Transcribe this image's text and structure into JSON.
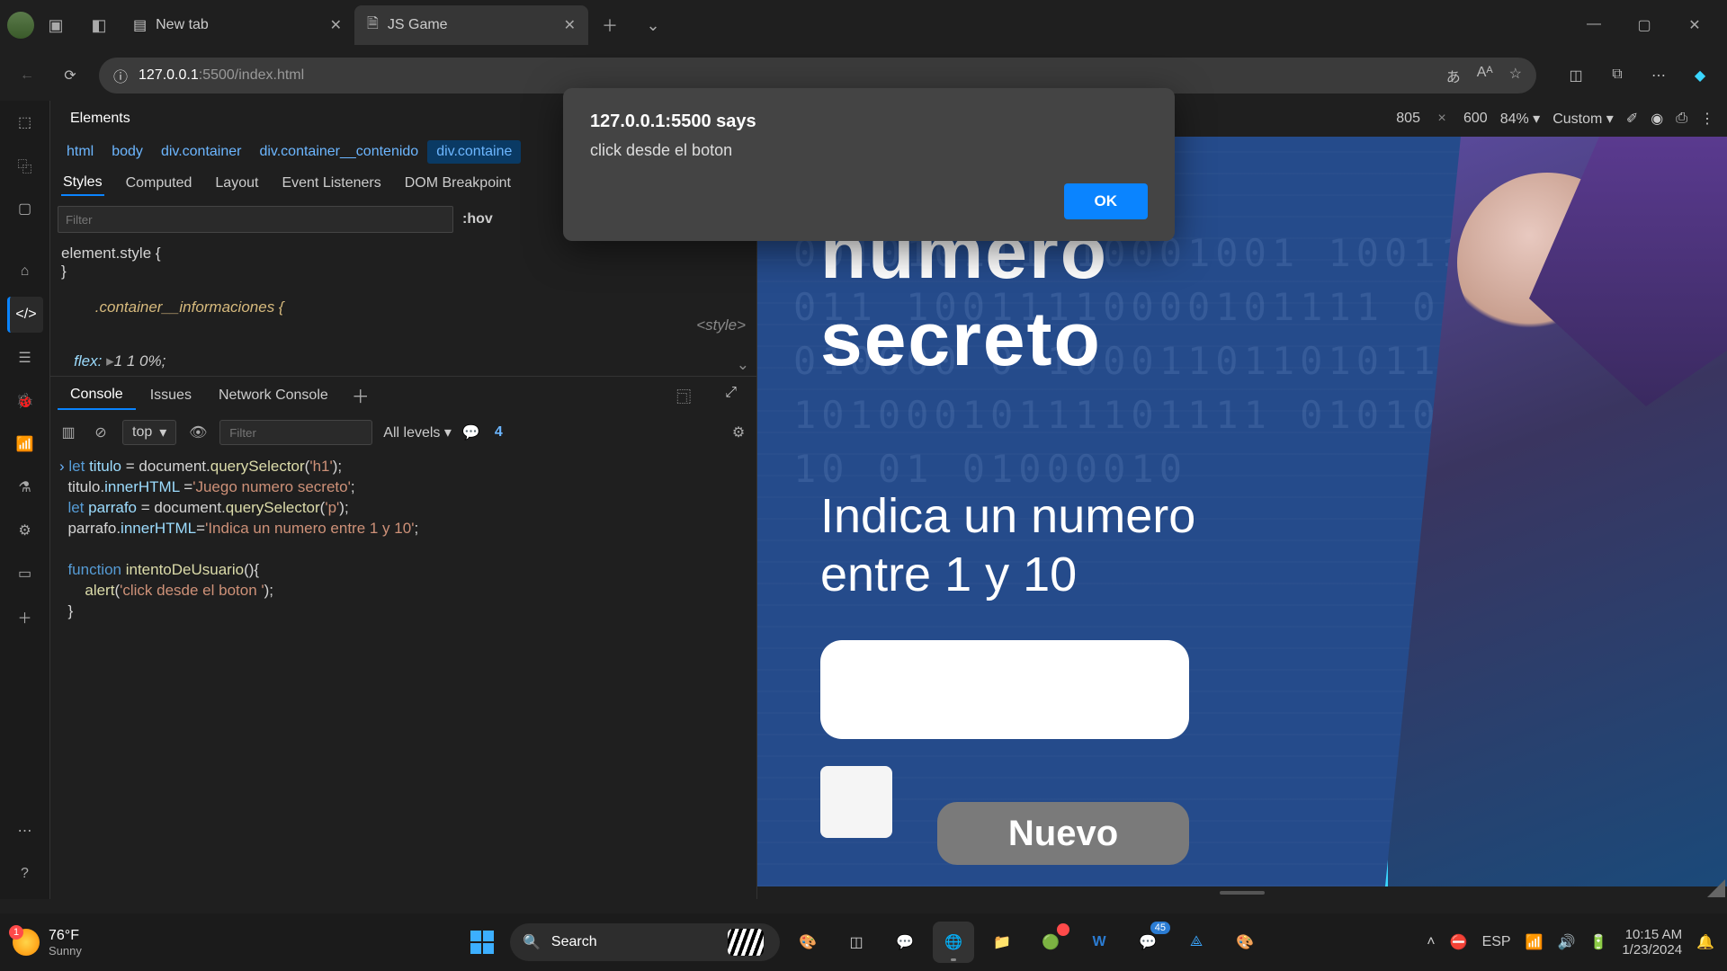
{
  "titlebar": {
    "tabs": [
      {
        "label": "New tab"
      },
      {
        "label": "JS Game"
      }
    ]
  },
  "address": {
    "host": "127.0.0.1",
    "port": ":5500",
    "path": "/index.html"
  },
  "devtools": {
    "top_tab": "Elements",
    "breadcrumb": [
      "html",
      "body",
      "div.container",
      "div.container__contenido",
      "div.containe"
    ],
    "styles_subtabs": [
      "Styles",
      "Computed",
      "Layout",
      "Event Listeners",
      "DOM Breakpoint"
    ],
    "filter_placeholder": "Filter",
    "hov": ":hov",
    "element_style_open": "element.style {",
    "element_style_close": "}",
    "rule_selector": ".container__informaciones {",
    "rule_prop": "flex",
    "rule_val": "1 1 0%",
    "rule_close": "}",
    "style_origin": "<style>",
    "console_tabs": [
      "Console",
      "Issues",
      "Network Console"
    ],
    "context": "top",
    "console_filter_placeholder": "Filter",
    "levels": "All levels",
    "issue_count": "4",
    "code_lines": [
      {
        "prompt": "›",
        "tokens": [
          [
            "kw",
            "let "
          ],
          [
            "var",
            "titulo"
          ],
          [
            "pn",
            " = "
          ],
          [
            "pn",
            "document."
          ],
          [
            "fn",
            "querySelector"
          ],
          [
            "pn",
            "("
          ],
          [
            "str",
            "'h1'"
          ],
          [
            "pn",
            ");"
          ]
        ]
      },
      {
        "tokens": [
          [
            "pn",
            "titulo."
          ],
          [
            "var",
            "innerHTML"
          ],
          [
            "pn",
            " ="
          ],
          [
            "str",
            "'Juego numero secreto'"
          ],
          [
            "pn",
            ";"
          ]
        ]
      },
      {
        "tokens": [
          [
            "kw",
            "let "
          ],
          [
            "var",
            "parrafo"
          ],
          [
            "pn",
            " = "
          ],
          [
            "pn",
            "document."
          ],
          [
            "fn",
            "querySelector"
          ],
          [
            "pn",
            "("
          ],
          [
            "str",
            "'p'"
          ],
          [
            "pn",
            ");"
          ]
        ]
      },
      {
        "tokens": [
          [
            "pn",
            "parrafo."
          ],
          [
            "var",
            "innerHTML"
          ],
          [
            "pn",
            "="
          ],
          [
            "str",
            "'Indica un numero entre 1 y 10'"
          ],
          [
            "pn",
            ";"
          ]
        ]
      },
      {
        "tokens": [
          [
            "pn",
            " "
          ]
        ]
      },
      {
        "tokens": [
          [
            "kw",
            "function "
          ],
          [
            "fn",
            "intentoDeUsuario"
          ],
          [
            "pn",
            "(){"
          ]
        ]
      },
      {
        "tokens": [
          [
            "pn",
            "    "
          ],
          [
            "fn",
            "alert"
          ],
          [
            "pn",
            "("
          ],
          [
            "str",
            "'click desde el boton '"
          ],
          [
            "pn",
            ");"
          ]
        ]
      },
      {
        "tokens": [
          [
            "pn",
            "}"
          ]
        ]
      }
    ]
  },
  "viewport": {
    "width": "805",
    "height": "600",
    "zoom": "84%",
    "device": "Custom"
  },
  "page": {
    "title_line1": "numero",
    "title_line2": "secreto",
    "subtitle_line1": "Indica un numero",
    "subtitle_line2": "entre 1 y 10",
    "btn2": "Nuevo",
    "bin_pattern": "001010111 10001001 1001101 0110 011 10011110000101111 0 011 011010000 0 100011011010111 1 110 10100010111101111 01010100 00 010 01 01000010 "
  },
  "alert": {
    "title": "127.0.0.1:5500 says",
    "message": "click desde el boton",
    "ok": "OK"
  },
  "taskbar": {
    "temp": "76°F",
    "cond": "Sunny",
    "badge": "1",
    "search": "Search",
    "whatsapp_badge": "45",
    "lang": "ESP",
    "time": "10:15 AM",
    "date": "1/23/2024"
  }
}
